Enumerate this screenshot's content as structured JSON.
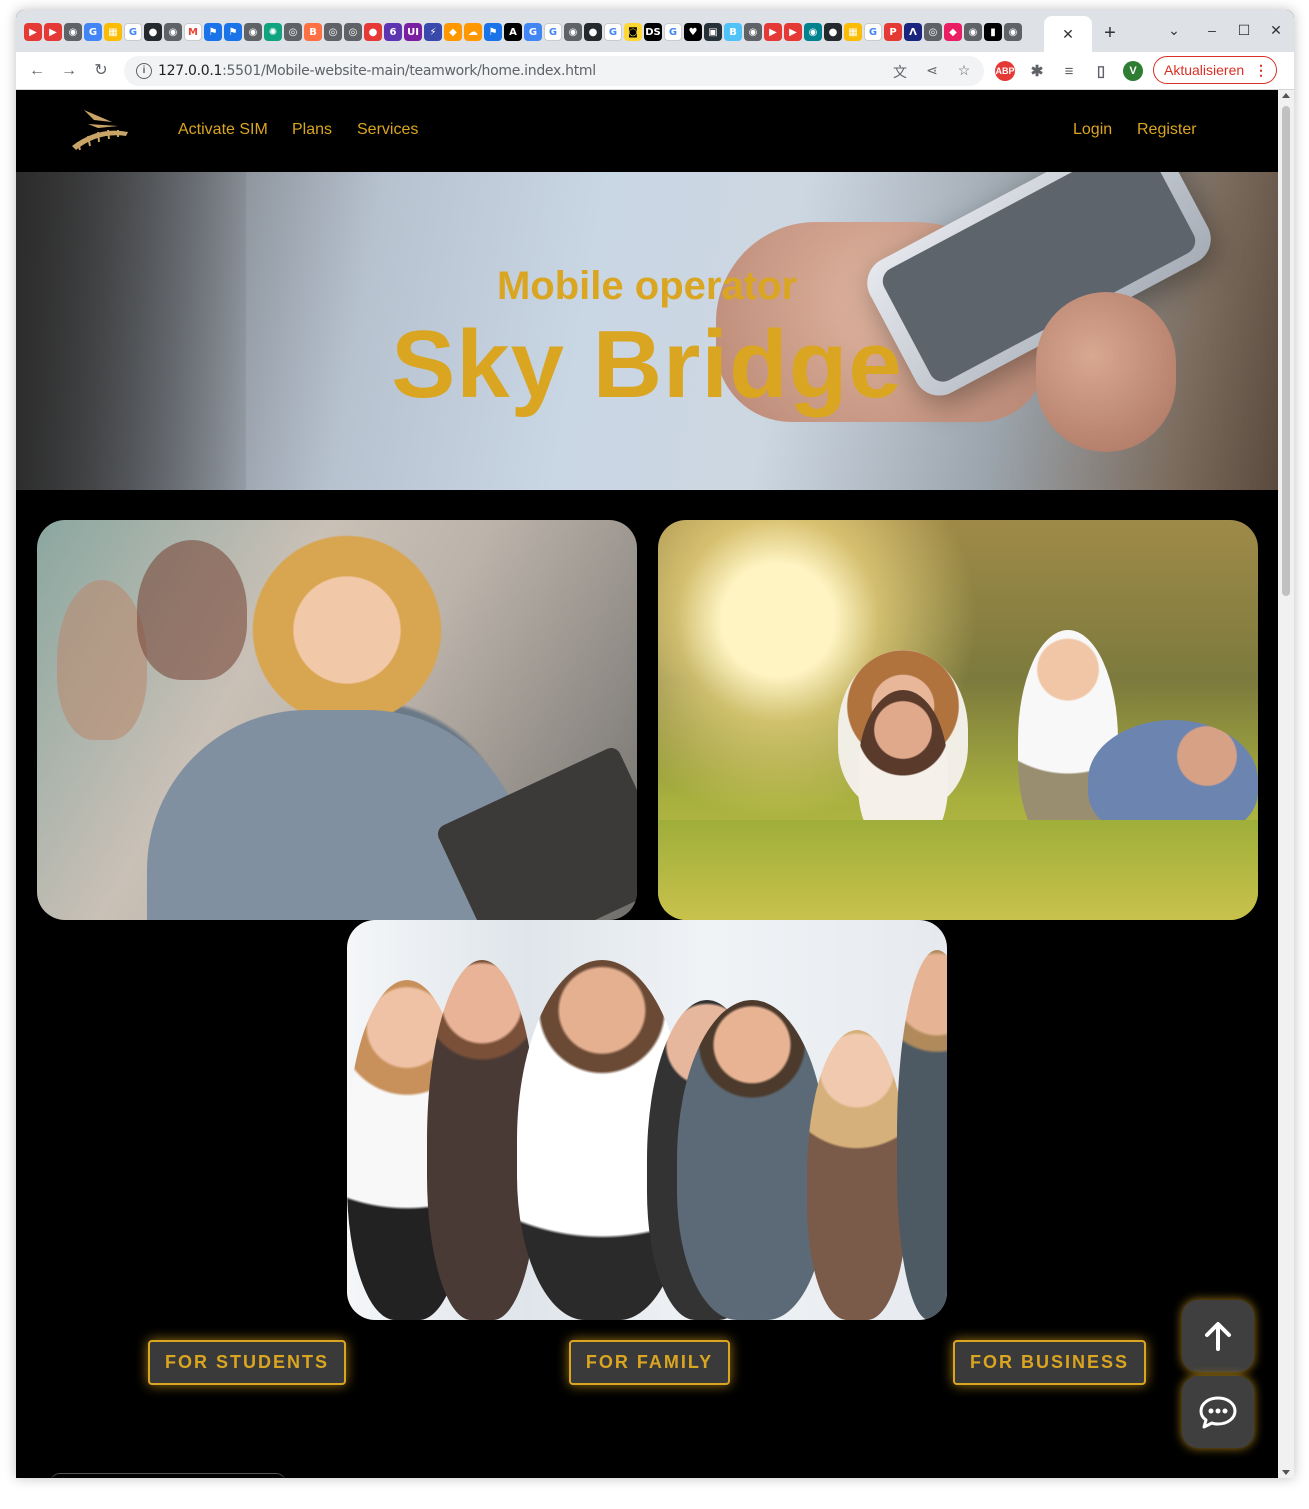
{
  "browser": {
    "tab_close": "✕",
    "new_tab": "+",
    "window_controls": [
      "⌄",
      "–",
      "☐",
      "✕"
    ],
    "url_host": "127.0.0.1",
    "url_rest": ":5501/Mobile-website-main/teamwork/home.index.html",
    "update_button": "Aktualisieren",
    "profile_initial": "V",
    "adblock_label": "ABP"
  },
  "nav": {
    "links": [
      "Activate SIM",
      "Plans",
      "Services"
    ],
    "login": "Login",
    "register": "Register"
  },
  "hero": {
    "subtitle": "Mobile operator",
    "title": "Sky Bridge"
  },
  "categories": [
    {
      "label": "FOR STUDENTS"
    },
    {
      "label": "FOR FAMILY"
    },
    {
      "label": "FOR BUSINESS"
    }
  ],
  "colors": {
    "accent": "#daa520",
    "background": "#000000",
    "button_bg": "#3a3a3a"
  },
  "icons": {
    "scroll_top": "arrow-up-icon",
    "chat": "chat-bubble-icon"
  }
}
